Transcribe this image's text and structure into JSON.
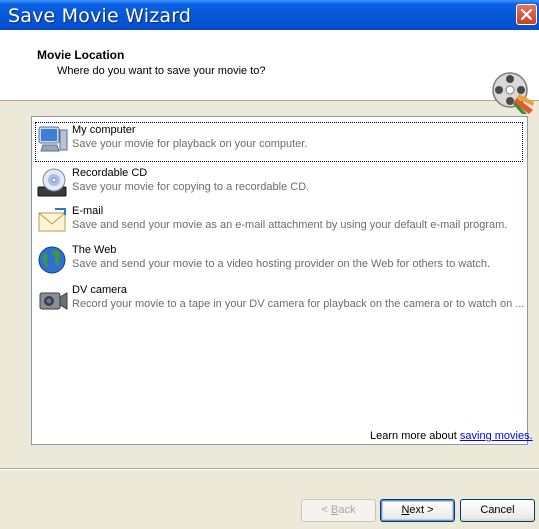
{
  "window": {
    "title": "Save Movie Wizard",
    "close_icon": "close-icon"
  },
  "header": {
    "title": "Movie Location",
    "subtitle": "Where do you want to save your movie to?",
    "icon": "movie-film-reel-icon"
  },
  "locations": [
    {
      "label": "My computer",
      "desc": "Save your movie for playback on your computer.",
      "icon": "computer-icon",
      "selected": true
    },
    {
      "label": "Recordable CD",
      "desc": "Save your movie for copying to a recordable CD.",
      "icon": "cd-drive-icon",
      "selected": false
    },
    {
      "label": "E-mail",
      "desc": "Save and send your movie as an e-mail attachment by using your default e-mail program.",
      "icon": "email-icon",
      "selected": false
    },
    {
      "label": "The Web",
      "desc": "Save and send your movie to a video hosting provider on the Web for others to watch.",
      "icon": "globe-icon",
      "selected": false
    },
    {
      "label": "DV camera",
      "desc": "Record your movie to a tape in your DV camera for playback on the camera or to watch on ...",
      "icon": "camcorder-icon",
      "selected": false
    }
  ],
  "learn_more": {
    "prefix": "Learn more about ",
    "link": "saving movies."
  },
  "buttons": {
    "back": {
      "hotkey": "B",
      "rest": "ack",
      "prefix": "< "
    },
    "next": {
      "hotkey": "N",
      "rest": "ext >"
    },
    "cancel": "Cancel"
  }
}
